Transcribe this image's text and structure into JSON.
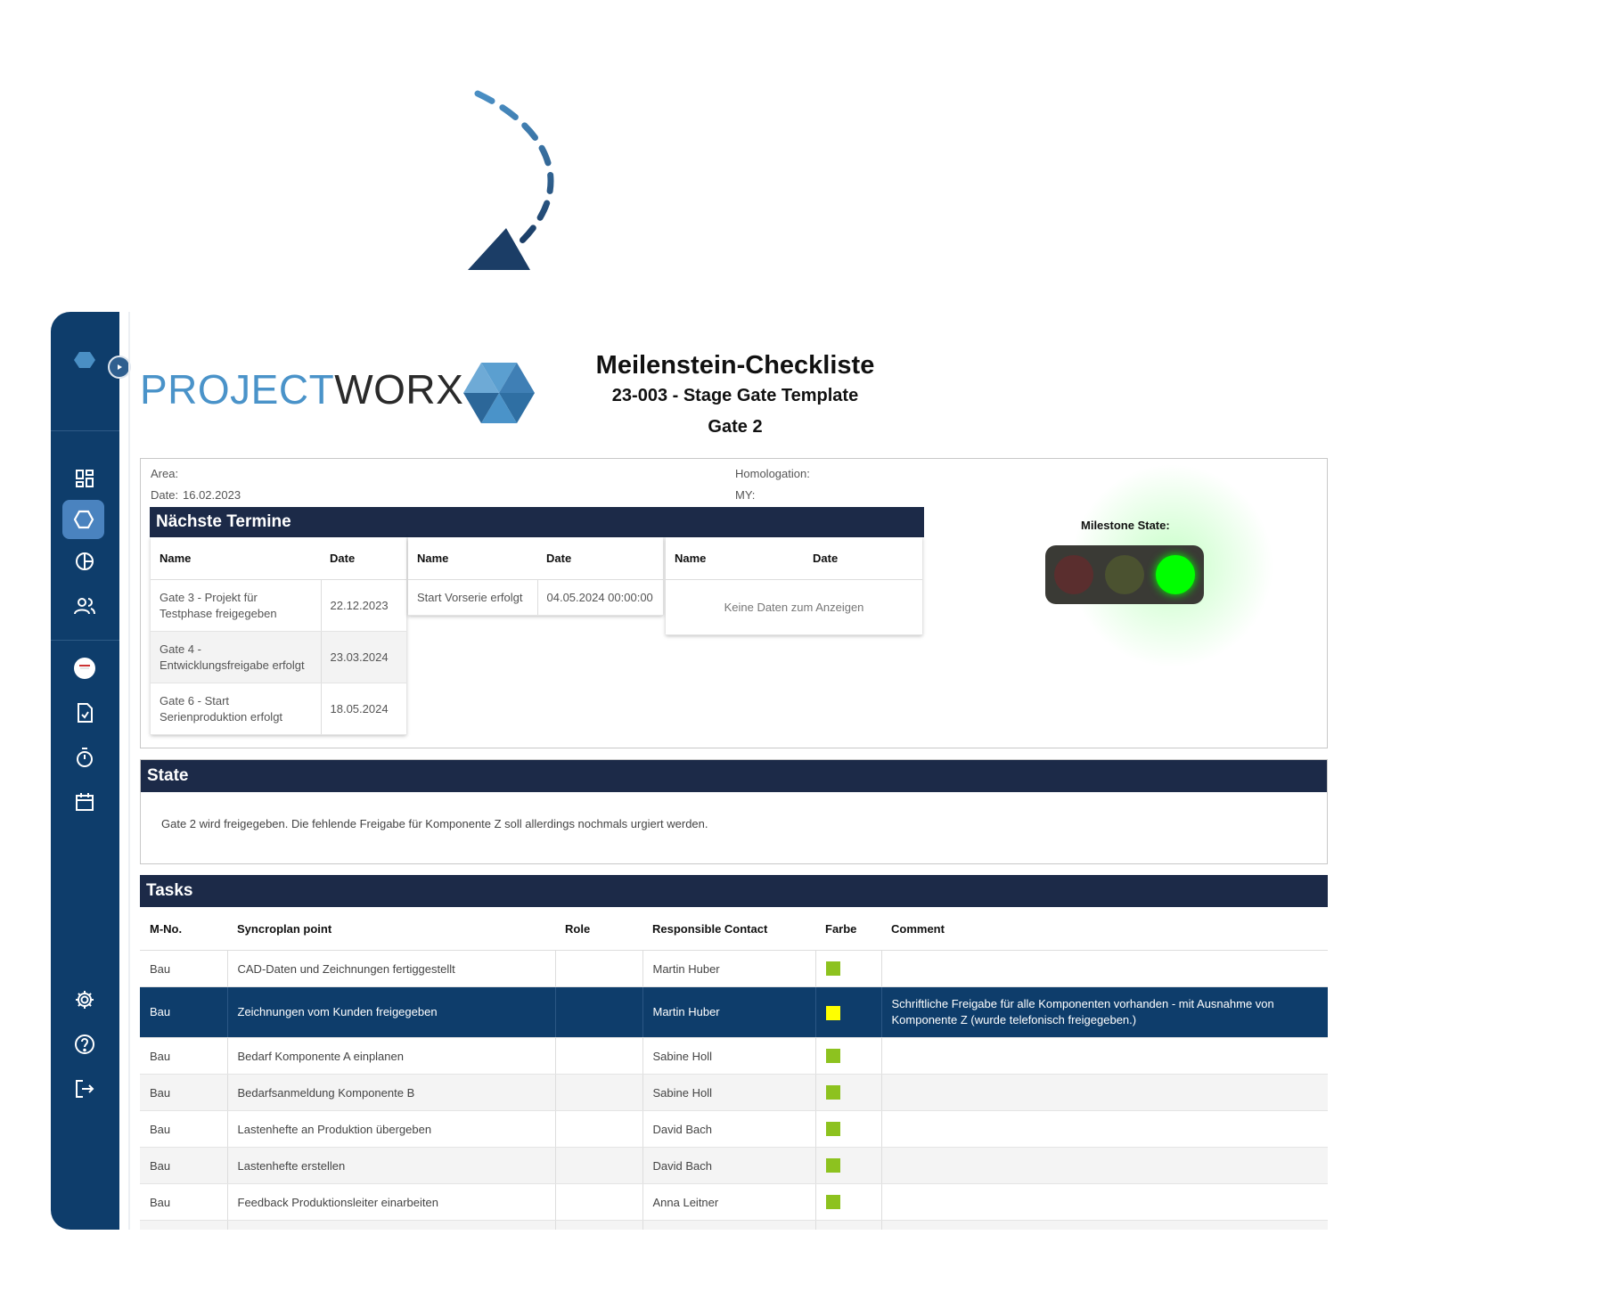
{
  "brand": {
    "part1": "PROJECT",
    "part2": "WORX"
  },
  "header": {
    "title": "Meilenstein-Checkliste",
    "subtitle": "23-003 - Stage Gate Template",
    "gate": "Gate 2"
  },
  "info": {
    "area_label": "Area:",
    "date_label": "Date:",
    "date_value": "16.02.2023",
    "homologation_label": "Homologation:",
    "my_label": "MY:"
  },
  "termine": {
    "title": "Nächste Termine",
    "col_name": "Name",
    "col_date": "Date",
    "table1": [
      {
        "name": "Gate 3 - Projekt für Testphase freigegeben",
        "date": "22.12.2023"
      },
      {
        "name": "Gate 4 - Entwicklungsfreigabe erfolgt",
        "date": "23.03.2024"
      },
      {
        "name": "Gate 6 - Start Serienproduktion erfolgt",
        "date": "18.05.2024"
      }
    ],
    "table2": [
      {
        "name": "Start Vorserie erfolgt",
        "date": "04.05.2024 00:00:00"
      }
    ],
    "table3_empty": "Keine Daten zum Anzeigen"
  },
  "milestone": {
    "label": "Milestone State:",
    "state": "green",
    "colors": {
      "red_off": "#5a2e2e",
      "yellow_off": "#4b5230",
      "green_on": "#00ff00"
    }
  },
  "state": {
    "title": "State",
    "text": "Gate 2 wird freigegeben. Die fehlende Freigabe für Komponente Z soll allerdings nochmals urgiert werden."
  },
  "tasks": {
    "title": "Tasks",
    "columns": [
      "M-No.",
      "Syncroplan point",
      "Role",
      "Responsible Contact",
      "Farbe",
      "Comment"
    ],
    "rows": [
      {
        "mno": "Bau",
        "point": "CAD-Daten und Zeichnungen fertiggestellt",
        "role": "",
        "contact": "Martin Huber",
        "color": "#8dc21f",
        "comment": ""
      },
      {
        "mno": "Bau",
        "point": "Zeichnungen vom Kunden freigegeben",
        "role": "",
        "contact": "Martin Huber",
        "color": "#ffff00",
        "comment": "Schriftliche Freigabe für alle Komponenten vorhanden - mit Ausnahme von Komponente Z (wurde telefonisch freigegeben.)"
      },
      {
        "mno": "Bau",
        "point": "Bedarf Komponente A einplanen",
        "role": "",
        "contact": "Sabine Holl",
        "color": "#8dc21f",
        "comment": ""
      },
      {
        "mno": "Bau",
        "point": "Bedarfsanmeldung Komponente B",
        "role": "",
        "contact": "Sabine Holl",
        "color": "#8dc21f",
        "comment": ""
      },
      {
        "mno": "Bau",
        "point": "Lastenhefte an Produktion übergeben",
        "role": "",
        "contact": "David Bach",
        "color": "#8dc21f",
        "comment": ""
      },
      {
        "mno": "Bau",
        "point": "Lastenhefte erstellen",
        "role": "",
        "contact": "David Bach",
        "color": "#8dc21f",
        "comment": ""
      },
      {
        "mno": "Bau",
        "point": "Feedback Produktionsleiter einarbeiten",
        "role": "",
        "contact": "Anna Leitner",
        "color": "#8dc21f",
        "comment": ""
      },
      {
        "mno": "",
        "point": "",
        "role": "",
        "contact": "",
        "color": "",
        "comment": ""
      }
    ]
  },
  "sidebar": {
    "items": [
      "dashboard-icon",
      "hexagon-icon",
      "pie-chart-icon",
      "users-icon",
      "avatar",
      "document-check-icon",
      "stopwatch-icon",
      "calendar-icon",
      "settings-icon",
      "help-icon",
      "logout-icon"
    ],
    "accent": "#0e3d6b",
    "active_color": "#4a83bf"
  }
}
